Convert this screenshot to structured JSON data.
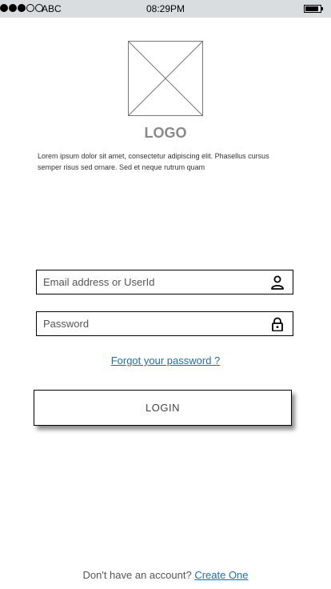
{
  "status_bar": {
    "carrier": "ABC",
    "time": "08:29PM",
    "signal_bars_filled": 3,
    "signal_bars_total": 5,
    "battery_level": 0.9
  },
  "logo": {
    "image_icon": "image-placeholder-icon",
    "text": "LOGO"
  },
  "intro_text": "Lorem ipsum dolor sit amet, consectetur adipiscing elit. Phasellus cursus semper risus sed ornare. Sed et neque rutrum quam",
  "form": {
    "email_placeholder": "Email address or UserId",
    "email_icon": "user-icon",
    "password_placeholder": "Password",
    "password_icon": "lock-icon",
    "forgot_label": "Forgot your password ?",
    "login_label": "LOGIN"
  },
  "footer": {
    "prompt": "Don't have an account?",
    "link_label": "Create One"
  },
  "colors": {
    "status_bar_bg": "#d9dde0",
    "link": "#1f6fae",
    "logo_text": "#8a8a8a"
  }
}
